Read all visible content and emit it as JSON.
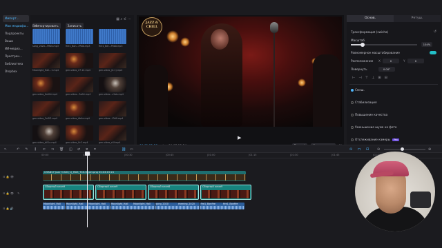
{
  "left_nav": [
    {
      "label": "Импорт..."
    },
    {
      "label": "Мои медиафа..."
    },
    {
      "label": "Подпроекты"
    },
    {
      "label": "Ваши"
    },
    {
      "label": "ИИ-медиа..."
    },
    {
      "label": "Простран..."
    },
    {
      "label": "Библиотека"
    },
    {
      "label": "Dropbox"
    }
  ],
  "media_toolbar": {
    "import_label": "Импортировать",
    "record_label": "Записать",
    "filter_label": "Все"
  },
  "media_items": [
    {
      "caption": "song_2020...FR00.mp3",
      "kind": "blue"
    },
    {
      "caption": "fire1_Bon...FR00.mp3",
      "kind": "blue"
    },
    {
      "caption": "fire1_Ber...FR00.mp3",
      "kind": "blue"
    },
    {
      "caption": "Moonlight_Hall...1.mp4",
      "kind": "scene"
    },
    {
      "caption": "gen-video_27.12.mp4",
      "kind": "scene2"
    },
    {
      "caption": "gen-video_(0.1).mp4",
      "kind": "scene"
    },
    {
      "caption": "gen-video_0a1fd.mp4",
      "kind": "scene2"
    },
    {
      "caption": "gen-video...3a04.mp4",
      "kind": "scene"
    },
    {
      "caption": "gen-video...c2ab.mp4",
      "kind": "scene3"
    },
    {
      "caption": "gen-video_2e3f2.mp4",
      "kind": "scene"
    },
    {
      "caption": "gen-video_Ab4e.mp4",
      "kind": "scene2"
    },
    {
      "caption": "gen-video...f3d9.mp4",
      "kind": "scene"
    },
    {
      "caption": "gen-video_b01a.mp4",
      "kind": "scene3"
    },
    {
      "caption": "gen-video_0c2.mp4",
      "kind": "scene2"
    },
    {
      "caption": "gen-video_e1f.mp4",
      "kind": "scene"
    }
  ],
  "player": {
    "logo_text": "JAZZ & CHILL",
    "current_time": "00:01:21:29",
    "total_time": "00:07:15:24",
    "btn_full": "Полный",
    "btn_ratio": "Соотн. сторон"
  },
  "inspector": {
    "tabs": [
      "Основ.",
      "Ретуш."
    ],
    "transform_label": "Трансформация (swisha)",
    "scale_label": "Масштаб",
    "scale_value": "104%",
    "uniform_label": "Равномерное масштабирование",
    "position_label": "Расположение",
    "pos_x_label": "X",
    "pos_x_value": "0",
    "pos_y_label": "Y",
    "pos_y_value": "0",
    "rotate_label": "Повернуть",
    "rotate_value": "0.00°",
    "blend_label": "Смеш.",
    "stabilize_label": "Стабилизация",
    "enhance_label": "Повышение качества",
    "denoise_label": "Уменьшение шума на фото",
    "track_label": "Отслеживание камеры",
    "badge": "Pro"
  },
  "timeline": {
    "ruler_ticks": [
      "00:00",
      "|00:15",
      "|00:30",
      "|00:45",
      "|01:00",
      "|01:15",
      "|01:30",
      "|01:45",
      "|02:00"
    ],
    "overlay_clip": "CHANCY Jazz+Chill (1)_RD3_TCS.30.Ari.png  00:03:15:24",
    "video_clips": [
      "Сборный клип9",
      "Сборный клип9",
      "Сборный клип8",
      "Сборный клип9"
    ],
    "audio_clips": [
      "Moonlight_Hall",
      "Moonlight_Hall",
      "Moonlight_Hall",
      "Moonlight_Hall",
      "Moonlight_Hall",
      "song_2020",
      "evening_2020",
      "fire1_Bonfire",
      "fire1_Bonfire"
    ]
  },
  "colors": {
    "accent": "#4fb8ff",
    "overlay_track": "#1e6e70",
    "video_track": "#17827e",
    "audio_track": "#2d5f9c"
  }
}
